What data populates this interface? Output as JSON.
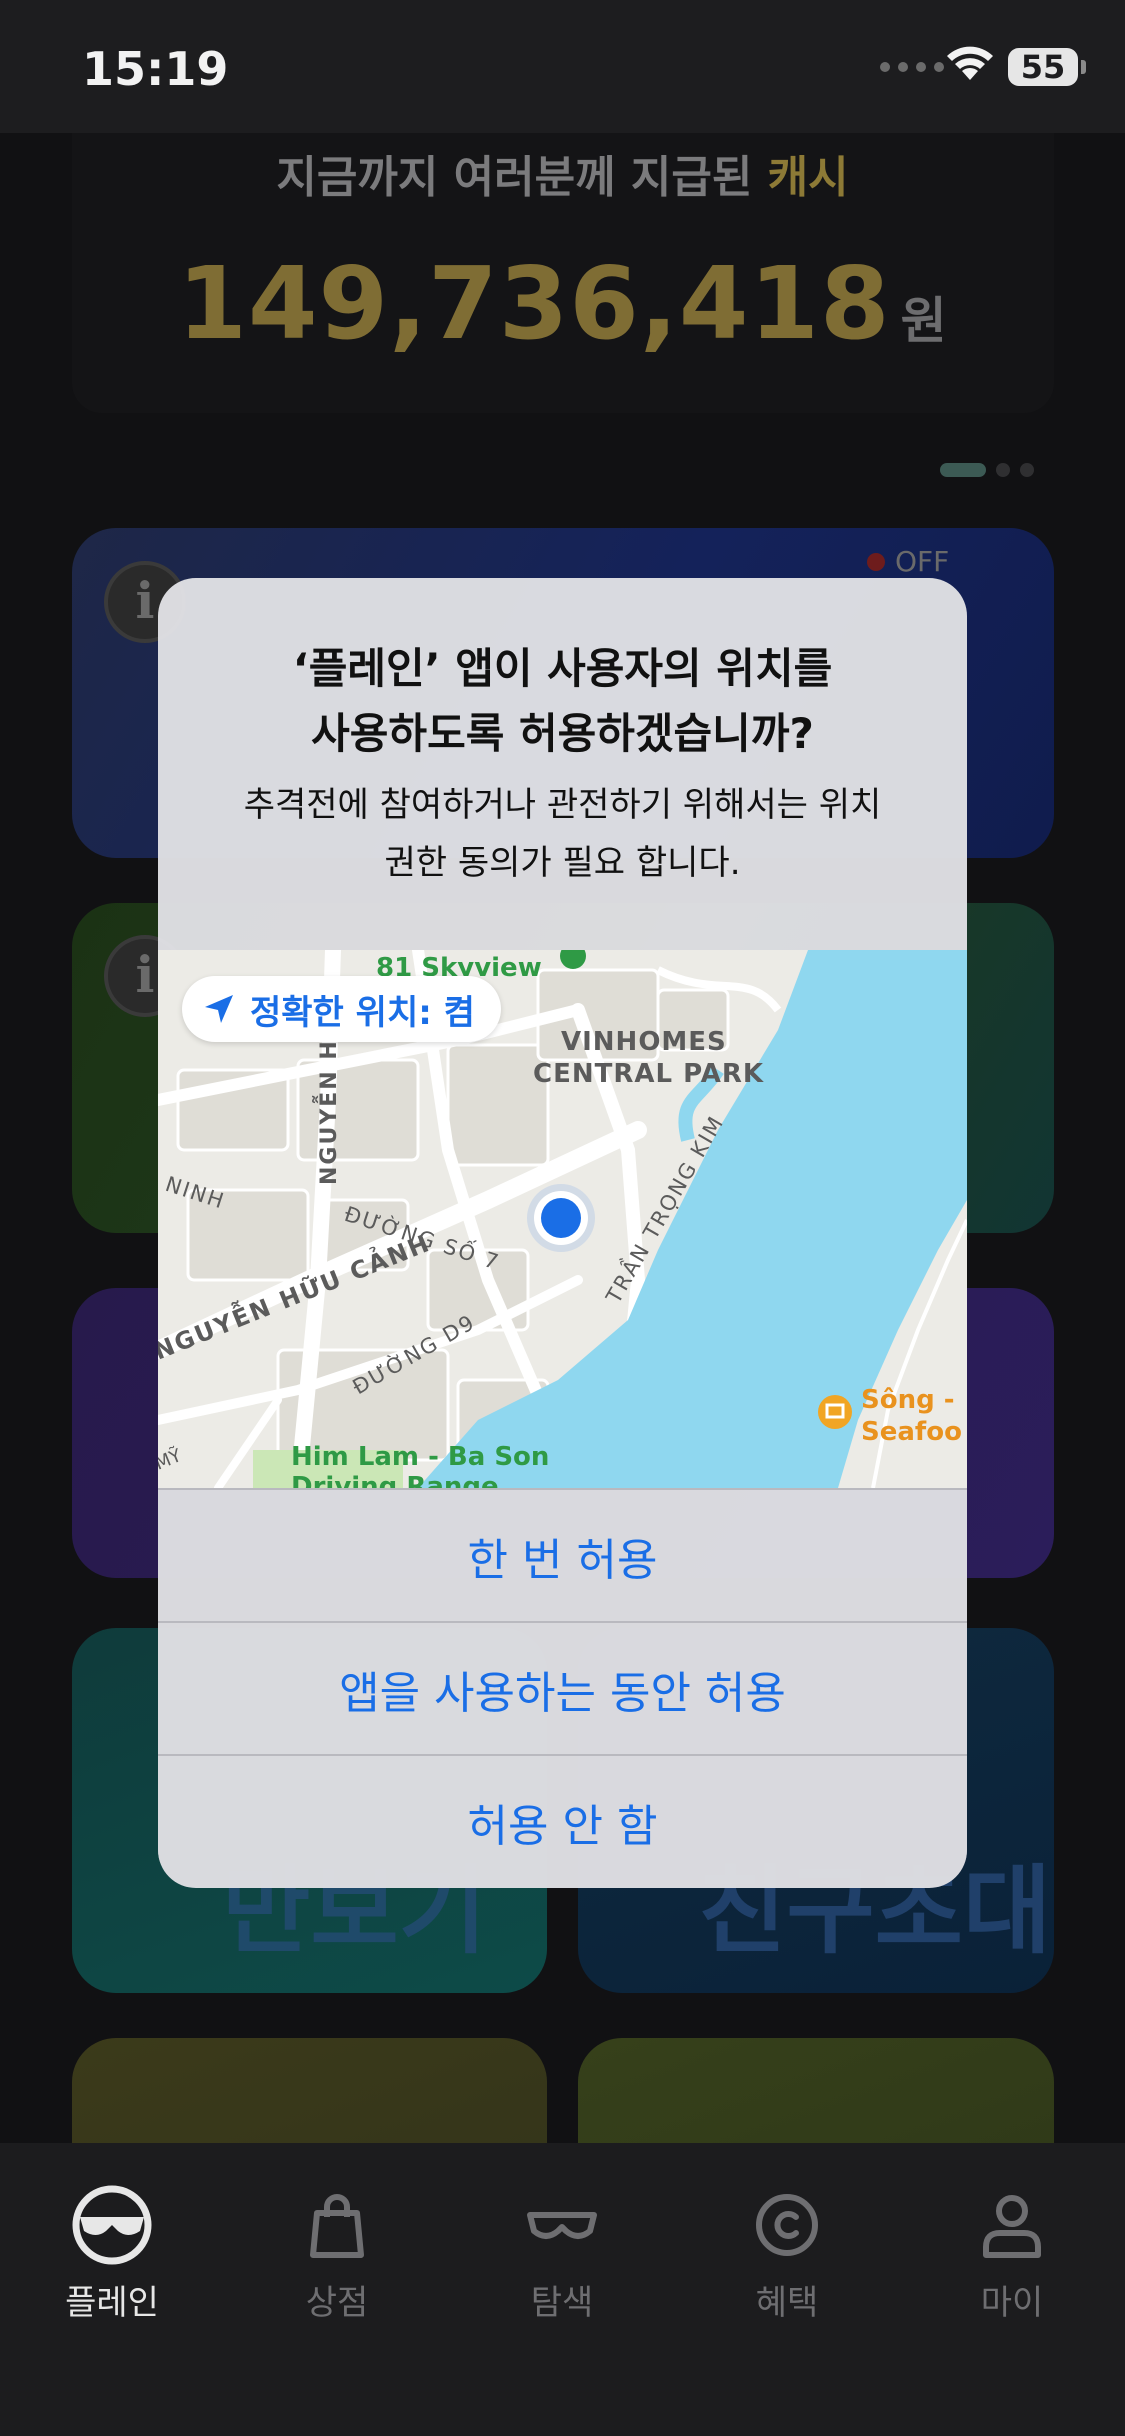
{
  "status_bar": {
    "time": "15:19",
    "battery": "55"
  },
  "background": {
    "cash_label": "지금까지 여러분께 지급된",
    "cash_label_accent": "캐시",
    "cash_amount": "149,736,418",
    "cash_unit": "원",
    "off_label": "OFF",
    "info_symbol": "i",
    "tile_word_left": "만보기",
    "tile_word_right": "친구초대"
  },
  "alert": {
    "title": "‘플레인’ 앱이 사용자의 위치를\n사용하도록 허용하겠습니까?",
    "message": "추격전에 참여하거나 관전하기 위해서는 위치\n권한 동의가 필요 합니다.",
    "precise_location": "정확한 위치: 켬",
    "map_labels": {
      "skyview": "81 Skyview",
      "vinhomes_1": "VINHOMES",
      "vinhomes_2": "CENTRAL PARK",
      "tran_trong_kim": "TRẦN TRỌNG KIM",
      "duong_so_7": "ĐƯỜNG SỐ 7",
      "duong_d9": "ĐƯỜNG D9",
      "nguyen_huu_canh": "NGUYỄN HỮU CẢNH",
      "nguyen_h": "NGUYỄN H",
      "ninh": "NINH",
      "my": "MỸ",
      "him_lam": "Him Lam - Ba Son",
      "driving_range": "Driving Range",
      "song_1": "Sông -",
      "song_2": "Seafoo"
    },
    "buttons": {
      "allow_once": "한 번 허용",
      "allow_while_using": "앱을 사용하는 동안 허용",
      "dont_allow": "허용 안 함"
    }
  },
  "tab_bar": {
    "items": [
      {
        "label": "플레인",
        "icon": "plane-mask-icon",
        "active": true
      },
      {
        "label": "상점",
        "icon": "shopping-bag-icon",
        "active": false
      },
      {
        "label": "탐색",
        "icon": "glasses-icon",
        "active": false
      },
      {
        "label": "혜택",
        "icon": "coin-icon",
        "active": false
      },
      {
        "label": "마이",
        "icon": "person-icon",
        "active": false
      }
    ]
  },
  "colors": {
    "accent_blue": "#1a6ee6",
    "water": "#8fd7ef",
    "pin": "#1a6ee6"
  }
}
